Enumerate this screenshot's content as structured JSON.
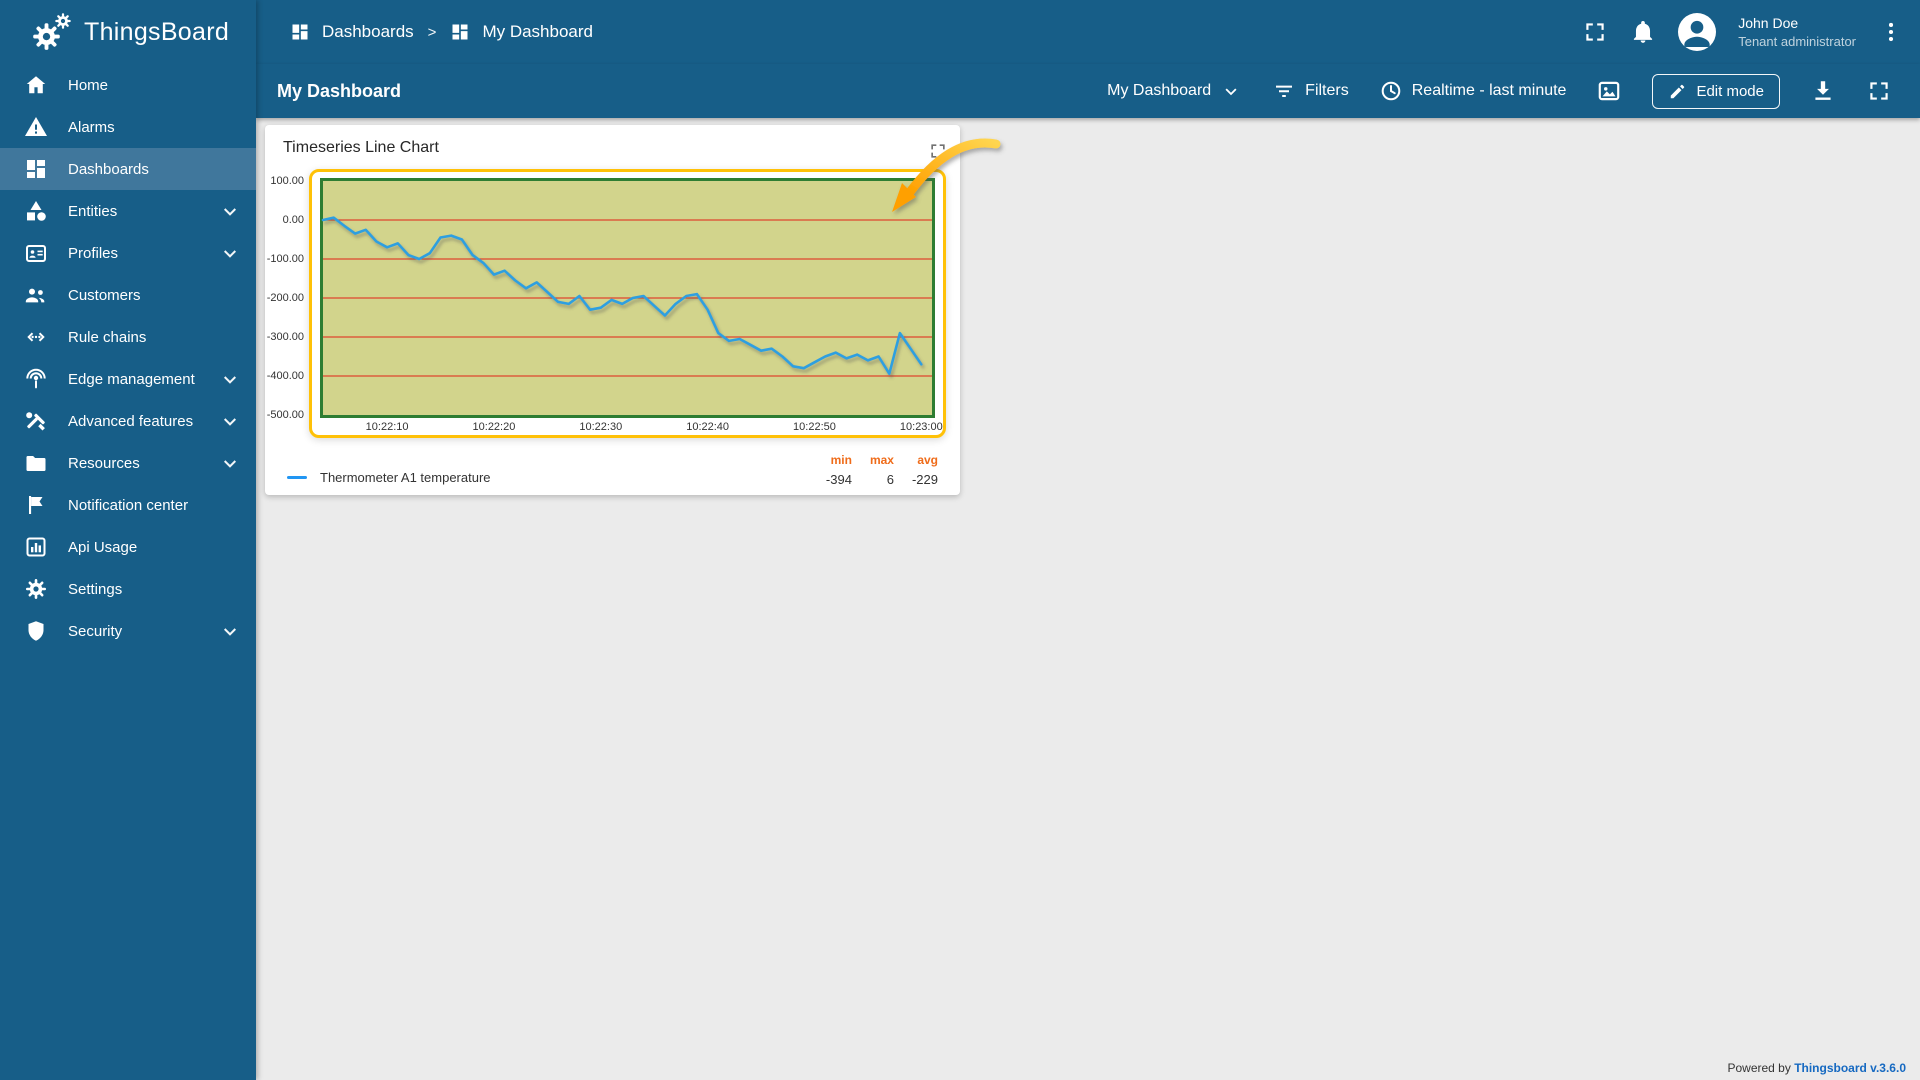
{
  "app": {
    "brand": "ThingsBoard",
    "footer_prefix": "Powered by",
    "footer_link": "Thingsboard v.3.6.0"
  },
  "colors": {
    "primary": "#175E88",
    "selected_nav": "#40779C",
    "content_bg": "#EBEBEB",
    "highlight": "#FFC107",
    "stat_header": "#EF6C1A",
    "legend_dash": "#2196F3",
    "footer_link": "#1669C1"
  },
  "sidebar": {
    "items": [
      {
        "label": "Home",
        "icon": "home-icon",
        "selected": false,
        "expandable": false
      },
      {
        "label": "Alarms",
        "icon": "warning-icon",
        "selected": false,
        "expandable": false
      },
      {
        "label": "Dashboards",
        "icon": "dashboards-icon",
        "selected": true,
        "expandable": false
      },
      {
        "label": "Entities",
        "icon": "category-icon",
        "selected": false,
        "expandable": true
      },
      {
        "label": "Profiles",
        "icon": "badge-icon",
        "selected": false,
        "expandable": true
      },
      {
        "label": "Customers",
        "icon": "people-icon",
        "selected": false,
        "expandable": false
      },
      {
        "label": "Rule chains",
        "icon": "rule-chain-icon",
        "selected": false,
        "expandable": false
      },
      {
        "label": "Edge management",
        "icon": "edge-icon",
        "selected": false,
        "expandable": true
      },
      {
        "label": "Advanced features",
        "icon": "tools-icon",
        "selected": false,
        "expandable": true
      },
      {
        "label": "Resources",
        "icon": "folder-icon",
        "selected": false,
        "expandable": true
      },
      {
        "label": "Notification center",
        "icon": "flag-icon",
        "selected": false,
        "expandable": false
      },
      {
        "label": "Api Usage",
        "icon": "chart-icon",
        "selected": false,
        "expandable": false
      },
      {
        "label": "Settings",
        "icon": "gear-icon",
        "selected": false,
        "expandable": false
      },
      {
        "label": "Security",
        "icon": "shield-icon",
        "selected": false,
        "expandable": true
      }
    ]
  },
  "breadcrumb": {
    "root": "Dashboards",
    "separator": ">",
    "current": "My Dashboard"
  },
  "user": {
    "name": "John Doe",
    "role": "Tenant administrator"
  },
  "toolbar": {
    "title": "My Dashboard",
    "dashboard_select": "My Dashboard",
    "filters_label": "Filters",
    "timewindow_label": "Realtime - last minute",
    "edit_button": "Edit mode"
  },
  "widget": {
    "title": "Timeseries Line Chart",
    "legend": {
      "series_label": "Thermometer A1 temperature",
      "min_label": "min",
      "max_label": "max",
      "avg_label": "avg",
      "min_value": "-394",
      "max_value": "6",
      "avg_value": "-229"
    }
  },
  "chart_data": {
    "type": "line",
    "title": "Timeseries Line Chart",
    "x_start_time": "10:22:04",
    "x_step_seconds": 1,
    "x_domain_seconds": [
      0,
      57
    ],
    "x_ticks": [
      {
        "seconds": 6,
        "label": "10:22:10"
      },
      {
        "seconds": 16,
        "label": "10:22:20"
      },
      {
        "seconds": 26,
        "label": "10:22:30"
      },
      {
        "seconds": 36,
        "label": "10:22:40"
      },
      {
        "seconds": 46,
        "label": "10:22:50"
      },
      {
        "seconds": 56,
        "label": "10:23:00"
      }
    ],
    "ylim": [
      -500,
      100
    ],
    "y_ticks": [
      100,
      0,
      -100,
      -200,
      -300,
      -400,
      -500
    ],
    "y_gridlines": [
      0,
      -100,
      -200,
      -300,
      -400
    ],
    "grid_on": true,
    "legend_position": "bottom",
    "plot_bg_color": "#D2D48C",
    "frame_color": "#2E7D32",
    "grid_color": "#E0462E",
    "highlight_color": "#FFC107",
    "series": [
      {
        "name": "Thermometer A1 temperature",
        "color": "#2E9FE0",
        "values": [
          0,
          6,
          -15,
          -35,
          -25,
          -55,
          -70,
          -60,
          -90,
          -100,
          -85,
          -45,
          -40,
          -50,
          -90,
          -110,
          -140,
          -130,
          -155,
          -175,
          -160,
          -185,
          -210,
          -215,
          -195,
          -230,
          -225,
          -205,
          -215,
          -200,
          -195,
          -220,
          -245,
          -215,
          -195,
          -190,
          -230,
          -290,
          -310,
          -305,
          -320,
          -335,
          -330,
          -350,
          -375,
          -380,
          -365,
          -350,
          -340,
          -355,
          -345,
          -360,
          -350,
          -394,
          -290,
          -330,
          -370
        ]
      }
    ],
    "stats": {
      "min": -394,
      "max": 6,
      "avg": -229
    }
  }
}
